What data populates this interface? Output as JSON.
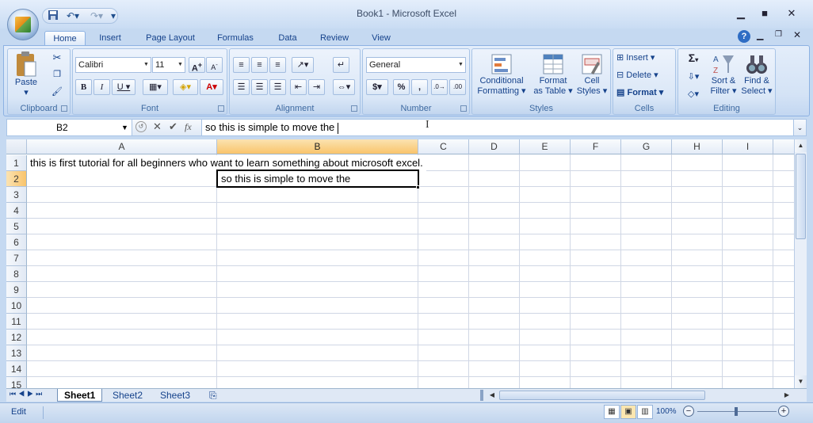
{
  "title_bar": {
    "window_title": "Book1 - Microsoft Excel",
    "qat_icons": [
      "save-icon",
      "undo-icon",
      "redo-icon",
      "customize-icon"
    ],
    "controls": {
      "minimize": "▁",
      "restore": "■",
      "close": "✕"
    }
  },
  "ribbon_tabs": [
    "Home",
    "Insert",
    "Page Layout",
    "Formulas",
    "Data",
    "Review",
    "View"
  ],
  "active_tab": "Home",
  "ribbon": {
    "clipboard": {
      "label": "Clipboard",
      "paste_label": "Paste"
    },
    "font": {
      "label": "Font",
      "font_name": "Calibri",
      "font_size": "11"
    },
    "alignment": {
      "label": "Alignment"
    },
    "number": {
      "label": "Number",
      "format": "General",
      "dollar": "$",
      "percent": "%",
      "comma": ","
    },
    "styles": {
      "label": "Styles",
      "conditional_line1": "Conditional",
      "conditional_line2": "Formatting ▾",
      "table_line1": "Format",
      "table_line2": "as Table ▾",
      "cell_line1": "Cell",
      "cell_line2": "Styles ▾"
    },
    "cells": {
      "label": "Cells",
      "insert": "Insert",
      "delete": "Delete",
      "format": "Format"
    },
    "editing": {
      "label": "Editing",
      "sigma": "Σ",
      "sort_line1": "Sort &",
      "sort_line2": "Filter ▾",
      "find_line1": "Find &",
      "find_line2": "Select ▾"
    }
  },
  "formula_bar": {
    "name_box": "B2",
    "fx": "fx",
    "content": "so this is simple to move the"
  },
  "columns": [
    "A",
    "B",
    "C",
    "D",
    "E",
    "F",
    "G",
    "H",
    "I"
  ],
  "selected_column": "B",
  "rows": [
    "1",
    "2",
    "3",
    "4",
    "5",
    "6",
    "7",
    "8",
    "9",
    "10",
    "11",
    "12",
    "13",
    "14",
    "15"
  ],
  "selected_row": "2",
  "cells": {
    "A1": "this is first tutorial for all beginners who want to learn something about microsoft excel.",
    "B2": "so this is simple to move the"
  },
  "sheets": [
    "Sheet1",
    "Sheet2",
    "Sheet3"
  ],
  "active_sheet": "Sheet1",
  "status": {
    "mode": "Edit",
    "zoom": "100%"
  }
}
